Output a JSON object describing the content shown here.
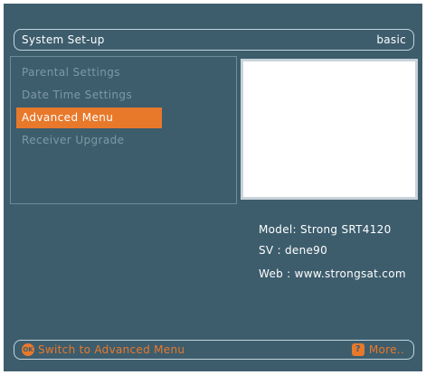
{
  "header": {
    "title": "System Set-up",
    "mode": "basic"
  },
  "menu": {
    "items": [
      {
        "label": "Parental Settings",
        "selected": false
      },
      {
        "label": "Date Time Settings",
        "selected": false
      },
      {
        "label": "Advanced Menu",
        "selected": true
      },
      {
        "label": "Receiver Upgrade",
        "selected": false
      }
    ]
  },
  "info": {
    "model": "Model: Strong SRT4120",
    "sv": "SV : dene90",
    "web": "Web : www.strongsat.com"
  },
  "footer": {
    "ok_key": "OK",
    "ok_action": "Switch to  Advanced Menu",
    "help_key": "?",
    "more": "More.."
  },
  "colors": {
    "background": "#3d5d6d",
    "accent": "#e8792b",
    "inactive_text": "#7e98a6",
    "border": "#c3d6df"
  },
  "icons": {
    "ok": "ok-button-icon",
    "help": "help-icon"
  }
}
